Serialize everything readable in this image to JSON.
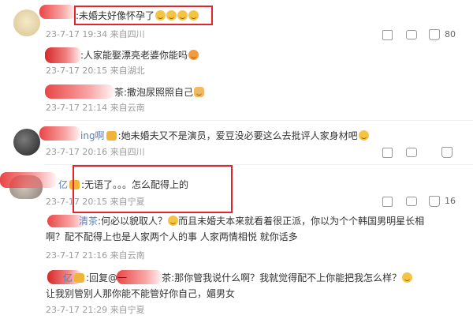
{
  "comments": [
    {
      "text": ":未婚夫好像怀孕了",
      "time": "23-7-17 19:34 来自四川",
      "likes": "80"
    },
    {
      "text": ":人家能娶漂亮老婆你能吗",
      "time": "23-7-17 20:15 来自湖北"
    },
    {
      "text": "茶:撒泡尿照照自己",
      "time": "23-7-17 21:14 来自云南"
    },
    {
      "name_fragment": "ing啊",
      "text": ":她未婚夫又不是演员，爱豆没必要这么去批评人家身材吧",
      "time": "23-7-17 20:16 来自四川"
    },
    {
      "name_fragment": "亿",
      "text": ":无语了。。。怎么配得上的",
      "time": "23-7-17 20:15 来自宁夏",
      "likes": "16"
    },
    {
      "name_fragment": "清茶",
      "text": ":何必以貌取人？",
      "text2": "而且未婚夫本来就看着很正派，你以为个个韩国男明星长相",
      "text3": "啊？配不配得上也是人家两个人的事 人家两情相悦 就你话多",
      "time": "23-7-17 21:16 来自云南"
    },
    {
      "name_fragment": "亿",
      "reply_prefix": ":回复@一",
      "reply_suffix": "茶:那你管我说什么啊？我就觉得配不上你能把我怎么样？",
      "text2": "让我别管别人那你能不能管好你自己，媚男女",
      "time": "23-7-17 21:29 来自宁夏"
    }
  ],
  "icons": {
    "share": "share-icon",
    "comment": "comment-icon",
    "like": "thumbs-up-icon",
    "emoji": "smile-emoji-icon",
    "badge": "vip-badge-icon"
  },
  "colors": {
    "highlight": "#e0262b",
    "meta": "#9a9a9a",
    "redaction": "#e83c3c"
  }
}
